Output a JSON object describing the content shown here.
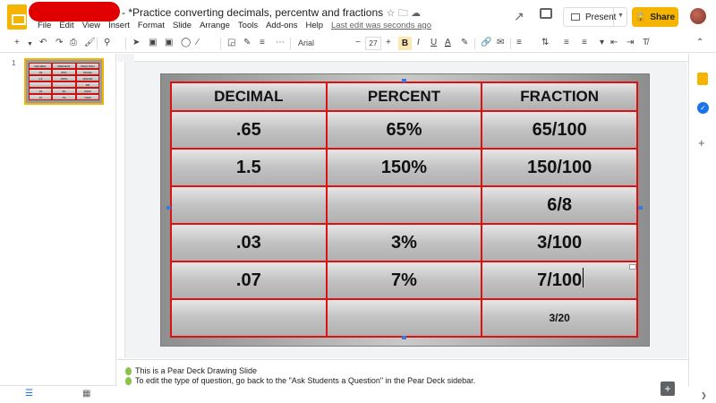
{
  "app": {
    "doc_title": "*Practice converting decimals, percentw and fractions",
    "last_edit": "Last edit was seconds ago",
    "menu": [
      "File",
      "Edit",
      "View",
      "Insert",
      "Format",
      "Slide",
      "Arrange",
      "Tools",
      "Add-ons",
      "Help"
    ],
    "present_label": "Present",
    "share_label": "Share",
    "brand_color": "#f4b400"
  },
  "toolbar": {
    "font": "Arial",
    "font_size": "27",
    "bold_label": "B",
    "italic_label": "I",
    "underline_label": "U",
    "text_color_label": "A"
  },
  "filmstrip": {
    "slide_number": "1",
    "thumb_cells": [
      "DECIMAL",
      "PERCENT",
      "FRACTION",
      ".65",
      "65%",
      "65/100",
      "1.5",
      "150%",
      "150/100",
      "",
      "",
      "6/8",
      ".03",
      "3%",
      "3/100",
      ".07",
      "7%",
      "7/100"
    ]
  },
  "slide": {
    "headers": [
      "DECIMAL",
      "PERCENT",
      "FRACTION"
    ],
    "rows": [
      [
        ".65",
        "65%",
        "65/100"
      ],
      [
        "1.5",
        "150%",
        "150/100"
      ],
      [
        "",
        "",
        "6/8"
      ],
      [
        ".03",
        "3%",
        "3/100"
      ],
      [
        ".07",
        "7%",
        "7/100"
      ],
      [
        "",
        "",
        "3/20"
      ]
    ],
    "border_color": "#dd1111"
  },
  "notes": {
    "line1": "This is a Pear Deck Drawing Slide",
    "line2": "To edit the type of question, go back to the \"Ask Students a Question\" in the Pear Deck sidebar."
  },
  "icons": {
    "trend": "activity-icon",
    "comments": "comment-history-icon",
    "keep": "keep-icon",
    "tasks": "tasks-icon"
  }
}
